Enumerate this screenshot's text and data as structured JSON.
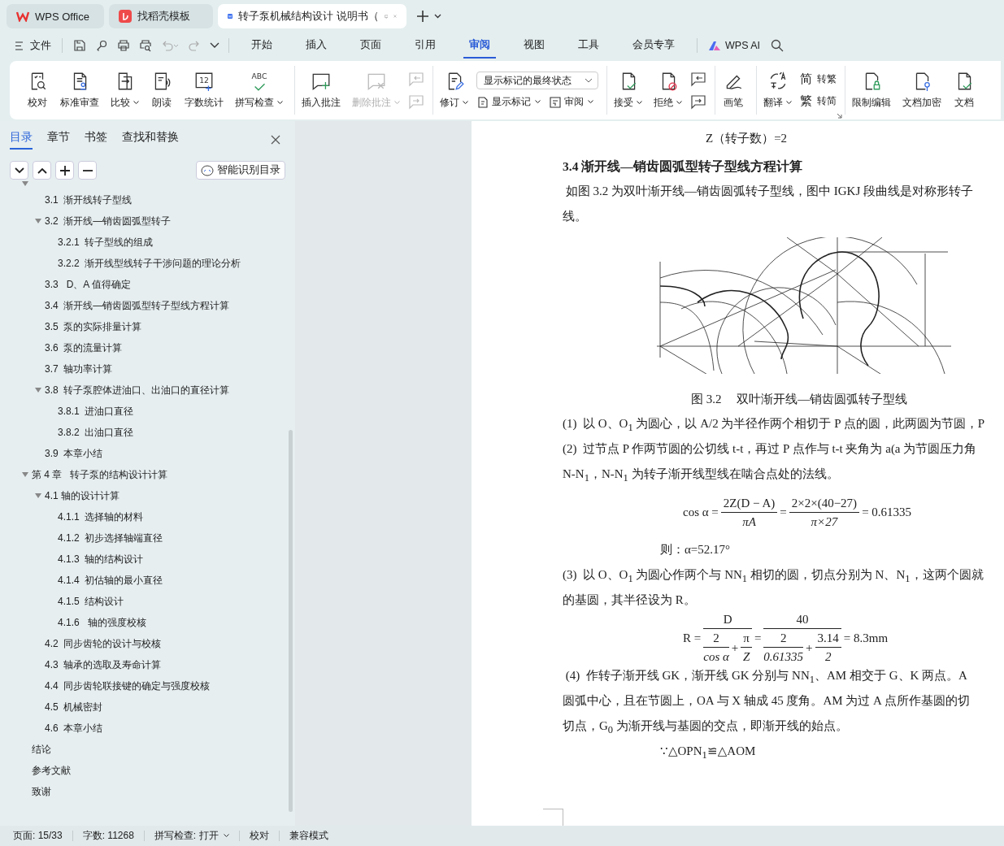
{
  "browser_tabs": [
    {
      "kind": "wps",
      "label": "WPS Office",
      "selected": false
    },
    {
      "kind": "template",
      "label": "找稻壳模板",
      "selected": false
    },
    {
      "kind": "doc",
      "label": "转子泵机械结构设计 说明书（",
      "selected": true
    }
  ],
  "menu": {
    "file": "文件",
    "tabs": [
      {
        "label": "开始",
        "selected": false
      },
      {
        "label": "插入",
        "selected": false
      },
      {
        "label": "页面",
        "selected": false
      },
      {
        "label": "引用",
        "selected": false
      },
      {
        "label": "审阅",
        "selected": true
      },
      {
        "label": "视图",
        "selected": false
      },
      {
        "label": "工具",
        "selected": false
      },
      {
        "label": "会员专享",
        "selected": false
      }
    ],
    "ai": "WPS AI"
  },
  "ribbon": {
    "groups": [
      {
        "items": [
          {
            "kind": "big",
            "label": "校对",
            "dropdown": false,
            "disabled": false
          },
          {
            "kind": "big",
            "label": "标准审查",
            "dropdown": false,
            "disabled": false
          },
          {
            "kind": "big",
            "label": "比较",
            "dropdown": true,
            "disabled": false
          },
          {
            "kind": "big",
            "label": "朗读",
            "dropdown": false,
            "disabled": false
          },
          {
            "kind": "big",
            "label": "字数统计",
            "icon_text": "12",
            "dropdown": false,
            "disabled": false
          },
          {
            "kind": "big",
            "label": "拼写检查",
            "icon_text": "ABC",
            "dropdown": true,
            "disabled": false
          }
        ]
      },
      {
        "items": [
          {
            "kind": "big",
            "label": "插入批注",
            "dropdown": false,
            "disabled": false
          },
          {
            "kind": "big",
            "label": "删除批注",
            "dropdown": true,
            "disabled": true
          },
          {
            "kind": "pair",
            "disabled": true
          }
        ]
      },
      {
        "items": [
          {
            "kind": "big",
            "label": "修订",
            "dropdown": true,
            "disabled": false
          },
          {
            "kind": "stack",
            "select": "显示标记的最终状态",
            "items": [
              {
                "label": "显示标记",
                "dropdown": true
              },
              {
                "label": "审阅",
                "dropdown": true
              }
            ]
          }
        ]
      },
      {
        "items": [
          {
            "kind": "big",
            "label": "接受",
            "dropdown": true,
            "disabled": false
          },
          {
            "kind": "big",
            "label": "拒绝",
            "dropdown": true,
            "disabled": false
          },
          {
            "kind": "pair",
            "disabled": false
          }
        ]
      },
      {
        "items": [
          {
            "kind": "big",
            "label": "画笔",
            "dropdown": false,
            "disabled": false
          }
        ]
      },
      {
        "items": [
          {
            "kind": "big",
            "label": "翻译",
            "dropdown": true,
            "disabled": false
          },
          {
            "kind": "stack",
            "items": [
              {
                "glyph": "简",
                "label": "转繁",
                "dropdown": false
              },
              {
                "glyph": "繁",
                "label": "转简",
                "dropdown": false
              }
            ]
          }
        ]
      },
      {
        "items": [
          {
            "kind": "big",
            "label": "限制编辑",
            "dropdown": false,
            "disabled": false
          },
          {
            "kind": "big",
            "label": "文档加密",
            "dropdown": false,
            "disabled": false
          },
          {
            "kind": "big",
            "label": "文档",
            "dropdown": false,
            "disabled": false
          }
        ]
      }
    ]
  },
  "sidebar": {
    "tabs": [
      {
        "label": "目录",
        "selected": true
      },
      {
        "label": "章节",
        "selected": false
      },
      {
        "label": "书签",
        "selected": false
      },
      {
        "label": "查找和替换",
        "selected": false
      }
    ],
    "smart_button": "智能识别目录",
    "toc": [
      {
        "expanded": true,
        "children": [
          {
            "label": "3.1  渐开线转子型线"
          },
          {
            "label": "3.2  渐开线—销齿圆弧型转子",
            "expanded": true,
            "children": [
              {
                "label": "3.2.1  转子型线的组成"
              },
              {
                "label": "3.2.2  渐开线型线转子干涉问题的理论分析"
              }
            ]
          },
          {
            "label": "3.3   D、A 值得确定"
          },
          {
            "label": "3.4  渐开线—销齿圆弧型转子型线方程计算"
          },
          {
            "label": "3.5  泵的实际排量计算"
          },
          {
            "label": "3.6  泵的流量计算"
          },
          {
            "label": "3.7  轴功率计算"
          },
          {
            "label": "3.8  转子泵腔体进油口、出油口的直径计算",
            "expanded": true,
            "children": [
              {
                "label": "3.8.1  进油口直径"
              },
              {
                "label": "3.8.2  出油口直径"
              }
            ]
          },
          {
            "label": "3.9  本章小结"
          }
        ]
      },
      {
        "label": "第 4 章   转子泵的结构设计计算",
        "expanded": true,
        "children": [
          {
            "label": "4.1 轴的设计计算",
            "expanded": true,
            "children": [
              {
                "label": "4.1.1  选择轴的材料"
              },
              {
                "label": "4.1.2  初步选择轴端直径"
              },
              {
                "label": "4.1.3  轴的结构设计"
              },
              {
                "label": "4.1.4  初估轴的最小直径"
              },
              {
                "label": "4.1.5  结构设计"
              },
              {
                "label": "4.1.6   轴的强度校核"
              }
            ]
          },
          {
            "label": "4.2  同步齿轮的设计与校核"
          },
          {
            "label": "4.3  轴承的选取及寿命计算"
          },
          {
            "label": "4.4  同步齿轮联接键的确定与强度校核"
          },
          {
            "label": "4.5  机械密封"
          },
          {
            "label": "4.6  本章小结"
          }
        ]
      },
      {
        "label": "结论"
      },
      {
        "label": "参考文献"
      },
      {
        "label": "致谢"
      }
    ]
  },
  "document": {
    "blocks": [
      {
        "kind": "center",
        "text": "Z（转子数）=2"
      },
      {
        "kind": "heading",
        "text": "3.4  渐开线—销齿圆弧型转子型线方程计算"
      },
      {
        "kind": "para",
        "lines": [
          " 如图 3.2 为双叶渐开线—销齿圆弧转子型线，图中 IGKJ 段曲线是对称形转子",
          "线。"
        ]
      },
      {
        "kind": "figure"
      },
      {
        "kind": "caption",
        "text": "图 3.2     双叶渐开线—销齿圆弧转子型线"
      },
      {
        "kind": "para",
        "lines": [
          "(1)  以 O、O$_{1}$ 为圆心，以 A/2 为半径作两个相切于 P 点的圆，此两圆为节圆，P",
          "(2)  过节点 P 作两节圆的公切线 t-t，再过 P 点作与 t-t 夹角为 a(a 为节圆压力角",
          "N-N$_{1}$，N-N$_{1}$ 为转子渐开线型线在啮合点处的法线。"
        ]
      },
      {
        "kind": "equation",
        "parts": [
          {
            "kind": "text",
            "text": "cos α ="
          },
          {
            "kind": "frac",
            "num": "2Z(D − A)",
            "den": "πA"
          },
          {
            "kind": "text",
            "text": "="
          },
          {
            "kind": "frac",
            "num": "2×2×(40−27)",
            "den": "π×27"
          },
          {
            "kind": "text",
            "text": "= 0.61335"
          }
        ]
      },
      {
        "kind": "indent",
        "text": "则：α=52.17°"
      },
      {
        "kind": "para",
        "lines": [
          "(3)  以 O、O$_{1}$ 为圆心作两个与 NN$_{1}$ 相切的圆，切点分别为 N、N$_{1}$，这两个圆就",
          "的基圆，其半径设为 R。"
        ]
      },
      {
        "kind": "equation",
        "parts": [
          {
            "kind": "text",
            "text": "R ="
          },
          {
            "kind": "frac",
            "num": "D",
            "den": [
              {
                "kind": "frac",
                "num": "2",
                "den": "cos α"
              },
              {
                "kind": "text",
                "text": "+"
              },
              {
                "kind": "frac",
                "num": "π",
                "den": "Z"
              }
            ]
          },
          {
            "kind": "text",
            "text": "="
          },
          {
            "kind": "frac",
            "num": "40",
            "den": [
              {
                "kind": "frac",
                "num": "2",
                "den": "0.61335"
              },
              {
                "kind": "text",
                "text": "+"
              },
              {
                "kind": "frac",
                "num": "3.14",
                "den": "2"
              }
            ]
          },
          {
            "kind": "text",
            "text": "= 8.3mm"
          }
        ]
      },
      {
        "kind": "para",
        "lines": [
          " (4)  作转子渐开线 GK，渐开线 GK 分别与 NN$_{1}$、AM 相交于 G、K 两点。A",
          "圆弧中心，且在节圆上，OA 与 X 轴成 45 度角。AM 为过 A 点所作基圆的切",
          "切点，G$_{0}$ 为渐开线与基圆的交点，即渐开线的始点。"
        ]
      },
      {
        "kind": "indent",
        "text": "∵△OPN$_{1}$≌△AOM"
      }
    ]
  },
  "status_bar": [
    {
      "kind": "text",
      "label": "页面: 15/33"
    },
    {
      "kind": "text",
      "label": "字数: 11268"
    },
    {
      "kind": "menu",
      "label": "拼写检查: 打开"
    },
    {
      "kind": "button",
      "label": "校对"
    },
    {
      "kind": "text",
      "label": "兼容模式"
    }
  ]
}
